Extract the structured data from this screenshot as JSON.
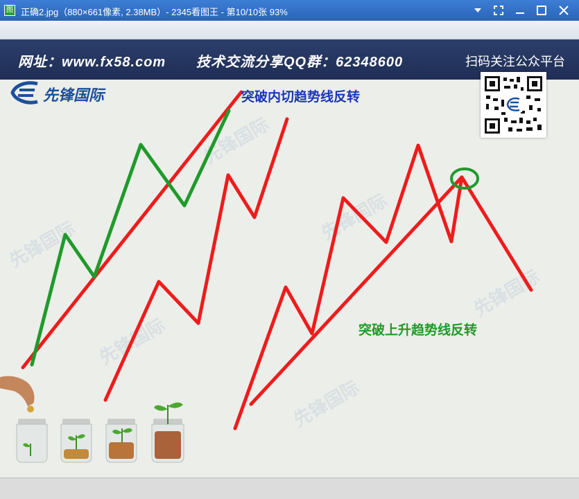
{
  "window": {
    "title": "正确2.jpg（880×661像素, 2.38MB）- 2345看图王 - 第10/10张 93%",
    "icon_text": "图"
  },
  "window_controls": [
    "chevron-down-icon",
    "fullscreen-icon",
    "minimize-icon",
    "maximize-icon",
    "close-icon"
  ],
  "image": {
    "banner": {
      "website": "网址：www.fx58.com",
      "qq_group": "技术交流分享QQ群：62348600",
      "qr_caption": "扫码关注公众平台"
    },
    "logo_text": "先锋国际",
    "labels": {
      "inner_tangent": "突破内切趋势线反转",
      "rising_trendline": "突破上升趋势线反转"
    },
    "colors": {
      "line_red": "#ee1c1c",
      "line_green": "#1f9a2a",
      "label_blue": "#1a35b8",
      "label_green": "#1e9a28",
      "banner": "#22335e"
    }
  }
}
